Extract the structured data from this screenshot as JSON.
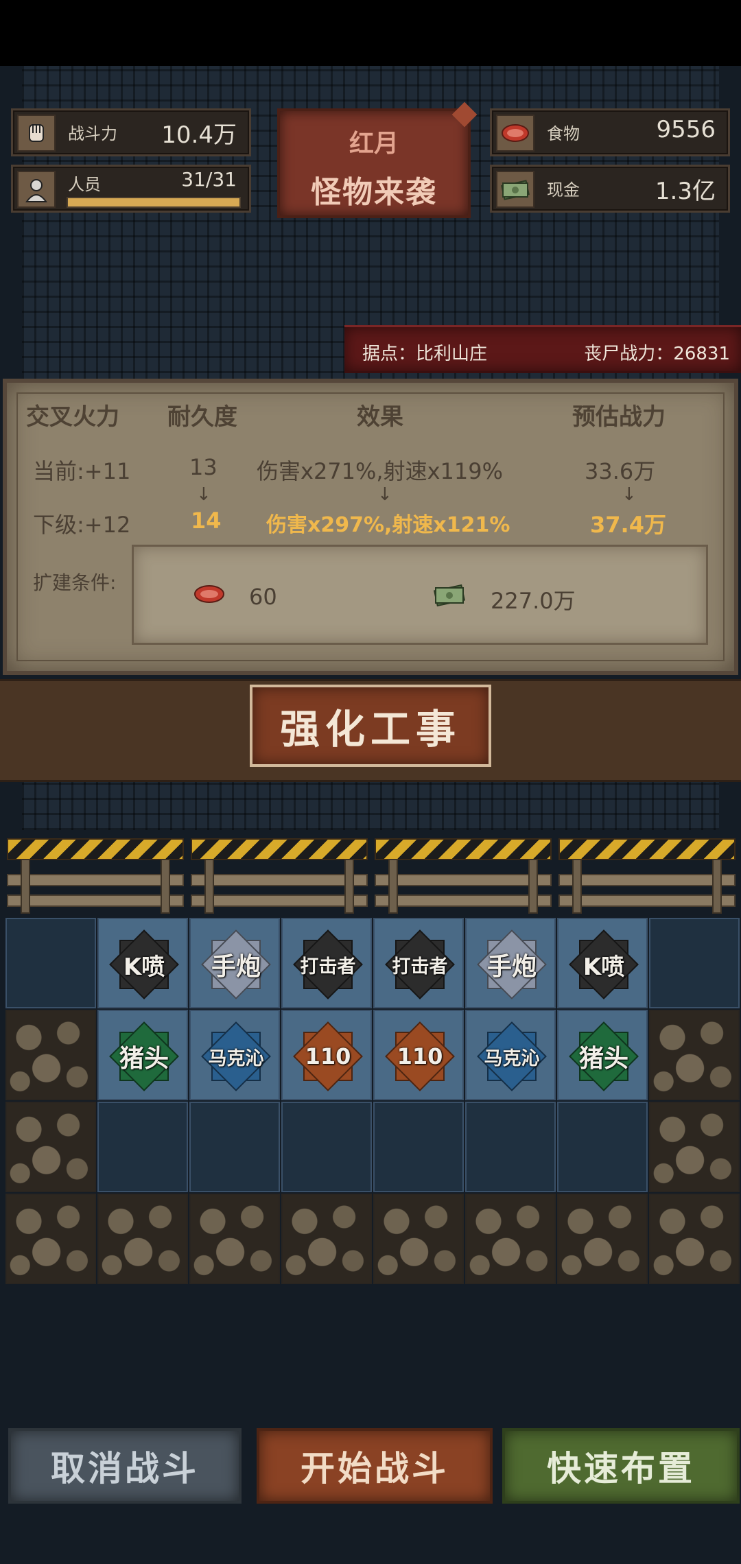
{
  "resources": {
    "combat_power": {
      "label": "战斗力",
      "value": "10.4万"
    },
    "personnel": {
      "label": "人员",
      "value": "31/31",
      "fill_fraction": 1.0
    },
    "food": {
      "label": "食物",
      "value": "9556"
    },
    "cash": {
      "label": "现金",
      "value": "1.3亿"
    }
  },
  "event": {
    "title": "红月",
    "subtitle": "怪物来袭"
  },
  "location": {
    "base": "据点：比利山庄",
    "zombie_power": "丧尸战力：26831"
  },
  "upgrade": {
    "headers": {
      "name": "交叉火力",
      "durability": "耐久度",
      "effect": "效果",
      "est_power": "预估战力"
    },
    "current": {
      "level": "当前:+11",
      "durability": "13",
      "effect": "伤害x271%,射速x119%",
      "est_power": "33.6万"
    },
    "next": {
      "level": "下级:+12",
      "durability": "14",
      "effect": "伤害x297%,射速x121%",
      "est_power": "37.4万"
    },
    "arrow": "↓",
    "requirements_label": "扩建条件:",
    "cost_food": "60",
    "cost_cash": "227.0万",
    "button": "强化工事"
  },
  "grid": {
    "row1": [
      {
        "label": "K喷",
        "color": "black"
      },
      {
        "label": "手炮",
        "color": "white"
      },
      {
        "label": "打击者",
        "color": "black"
      },
      {
        "label": "打击者",
        "color": "black"
      },
      {
        "label": "手炮",
        "color": "white"
      },
      {
        "label": "K喷",
        "color": "black"
      }
    ],
    "row2": [
      {
        "label": "猪头",
        "color": "green"
      },
      {
        "label": "马克沁",
        "color": "blue"
      },
      {
        "label": "110",
        "color": "orange"
      },
      {
        "label": "110",
        "color": "orange"
      },
      {
        "label": "马克沁",
        "color": "blue"
      },
      {
        "label": "猪头",
        "color": "green"
      }
    ]
  },
  "buttons": {
    "cancel": "取消战斗",
    "start": "开始战斗",
    "quick": "快速布置"
  }
}
